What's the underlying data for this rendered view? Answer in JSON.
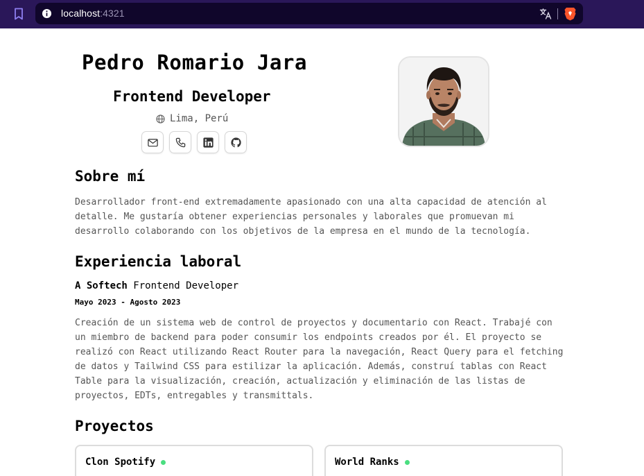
{
  "browser": {
    "url_host": "localhost",
    "url_port": ":4321",
    "icons": [
      "bookmark-icon",
      "info-icon",
      "translate-icon",
      "brave-icon"
    ]
  },
  "profile": {
    "name": "Pedro Romario Jara",
    "role": "Frontend Developer",
    "location": "Lima, Perú",
    "contact_icons": [
      "mail-icon",
      "phone-icon",
      "linkedin-icon",
      "github-icon"
    ]
  },
  "about": {
    "title": "Sobre mí",
    "text": "Desarrollador front-end extremadamente apasionado con una alta capacidad de atención al detalle. Me gustaría obtener experiencias personales y laborales que promuevan mi desarrollo colaborando con los objetivos de la empresa en el mundo de la tecnología."
  },
  "experience": {
    "title": "Experiencia laboral",
    "company": "A Softech",
    "position": "Frontend Developer",
    "dates": "Mayo 2023 - Agosto 2023",
    "description": "Creación de un sistema web de control de proyectos y documentario con React. Trabajé con un miembro de backend para poder consumir los endpoints creados por él. El proyecto se realizó con React utilizando React Router para la navegación, React Query para el fetching de datos y Tailwind CSS para estilizar la aplicación. Además, construí tablas con React Table para la visualización, creación, actualización y eliminación de las listas de proyectos, EDTs, entregables y transmittals."
  },
  "projects": {
    "title": "Proyectos",
    "items": [
      {
        "name": "Clon Spotify",
        "status_color": "#4ade80"
      },
      {
        "name": "World Ranks",
        "status_color": "#4ade80"
      }
    ]
  }
}
